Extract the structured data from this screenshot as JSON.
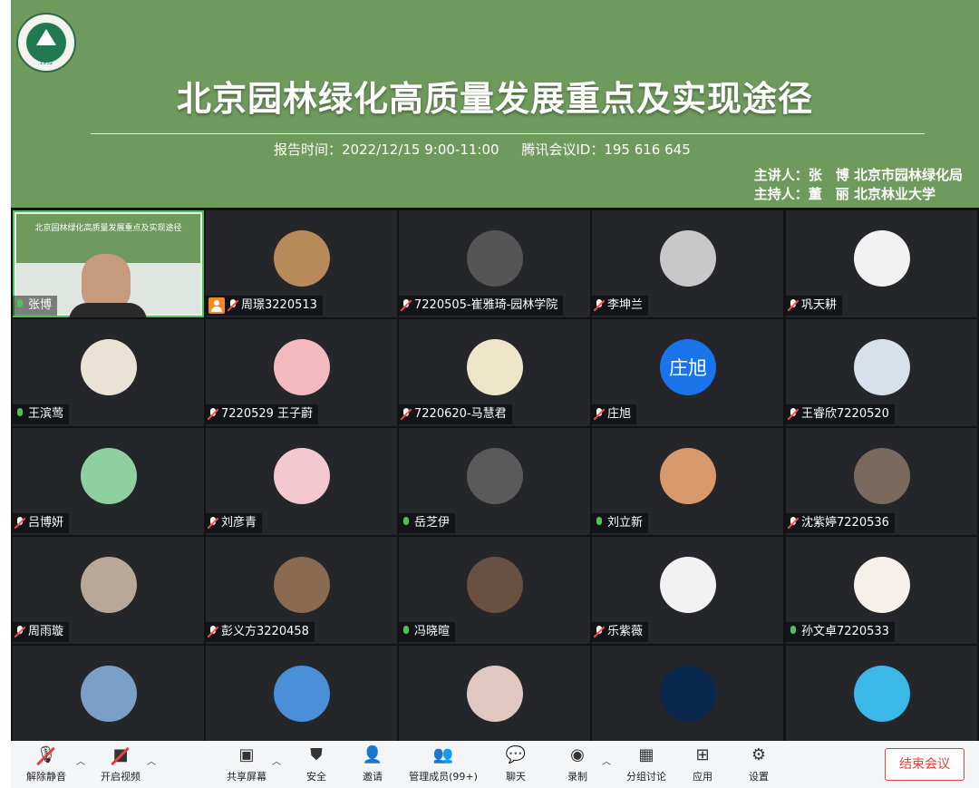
{
  "banner": {
    "title": "北京园林绿化高质量发展重点及实现途径",
    "logo_year": "1952",
    "time_label": "报告时间：2022/12/15  9:00-11:00",
    "meeting_id_label": "腾讯会议ID：195 616 645",
    "speaker_line": "主讲人：张　博  北京市园林绿化局",
    "host_line": "主持人：董　丽  北京林业大学",
    "color": "#6f9a5d"
  },
  "participants": [
    {
      "name": "张博",
      "muted": false,
      "avatar_color": "#c79a7c",
      "active": true
    },
    {
      "name": "周璟3220513",
      "muted": true,
      "avatar_color": "#b78a5a",
      "badge": true
    },
    {
      "name": "7220505-崔雅琦-园林学院",
      "muted": true,
      "avatar_color": "#555555"
    },
    {
      "name": "李坤兰",
      "muted": true,
      "avatar_color": "#c8c8c8"
    },
    {
      "name": "巩天耕",
      "muted": true,
      "avatar_color": "#f2f2f2"
    },
    {
      "name": "王滨莺",
      "muted": false,
      "avatar_color": "#e9e2d5"
    },
    {
      "name": "7220529 王子蔚",
      "muted": true,
      "avatar_color": "#f2b9c0"
    },
    {
      "name": "7220620-马慧君",
      "muted": true,
      "avatar_color": "#eee6c8"
    },
    {
      "name": "庄旭",
      "muted": true,
      "avatar_color": "#1a73e8",
      "avatar_text": "庄旭"
    },
    {
      "name": "王睿欣7220520",
      "muted": true,
      "avatar_color": "#d8e0ea"
    },
    {
      "name": "吕博妍",
      "muted": true,
      "avatar_color": "#8fd0a0"
    },
    {
      "name": "刘彦青",
      "muted": true,
      "avatar_color": "#f4c8d0"
    },
    {
      "name": "岳芝伊",
      "muted": false,
      "avatar_color": "#5a5a5a"
    },
    {
      "name": "刘立新",
      "muted": false,
      "avatar_color": "#d89a6c"
    },
    {
      "name": "沈紫婷7220536",
      "muted": true,
      "avatar_color": "#7a6a5e"
    },
    {
      "name": "周雨璇",
      "muted": true,
      "avatar_color": "#b8a898"
    },
    {
      "name": "彭义方3220458",
      "muted": true,
      "avatar_color": "#8a6a50"
    },
    {
      "name": "冯晓暄",
      "muted": false,
      "avatar_color": "#6a5040"
    },
    {
      "name": "乐紫薇",
      "muted": true,
      "avatar_color": "#f2f2f2"
    },
    {
      "name": "孙文卓7220533",
      "muted": false,
      "avatar_color": "#f5f0ea"
    },
    {
      "name": "",
      "muted": false,
      "avatar_color": "#7aa0c8"
    },
    {
      "name": "",
      "muted": false,
      "avatar_color": "#4a90d8"
    },
    {
      "name": "",
      "muted": false,
      "avatar_color": "#e0c8c0"
    },
    {
      "name": "",
      "muted": false,
      "avatar_color": "#0a2850"
    },
    {
      "name": "",
      "muted": false,
      "avatar_color": "#3ab8e8"
    }
  ],
  "toolbar": {
    "unmute": "解除静音",
    "video": "开启视频",
    "share": "共享屏幕",
    "security": "安全",
    "invite": "邀请",
    "members": "管理成员(99+)",
    "chat": "聊天",
    "record": "录制",
    "breakout": "分组讨论",
    "apps": "应用",
    "settings": "设置",
    "end": "结束会议"
  }
}
